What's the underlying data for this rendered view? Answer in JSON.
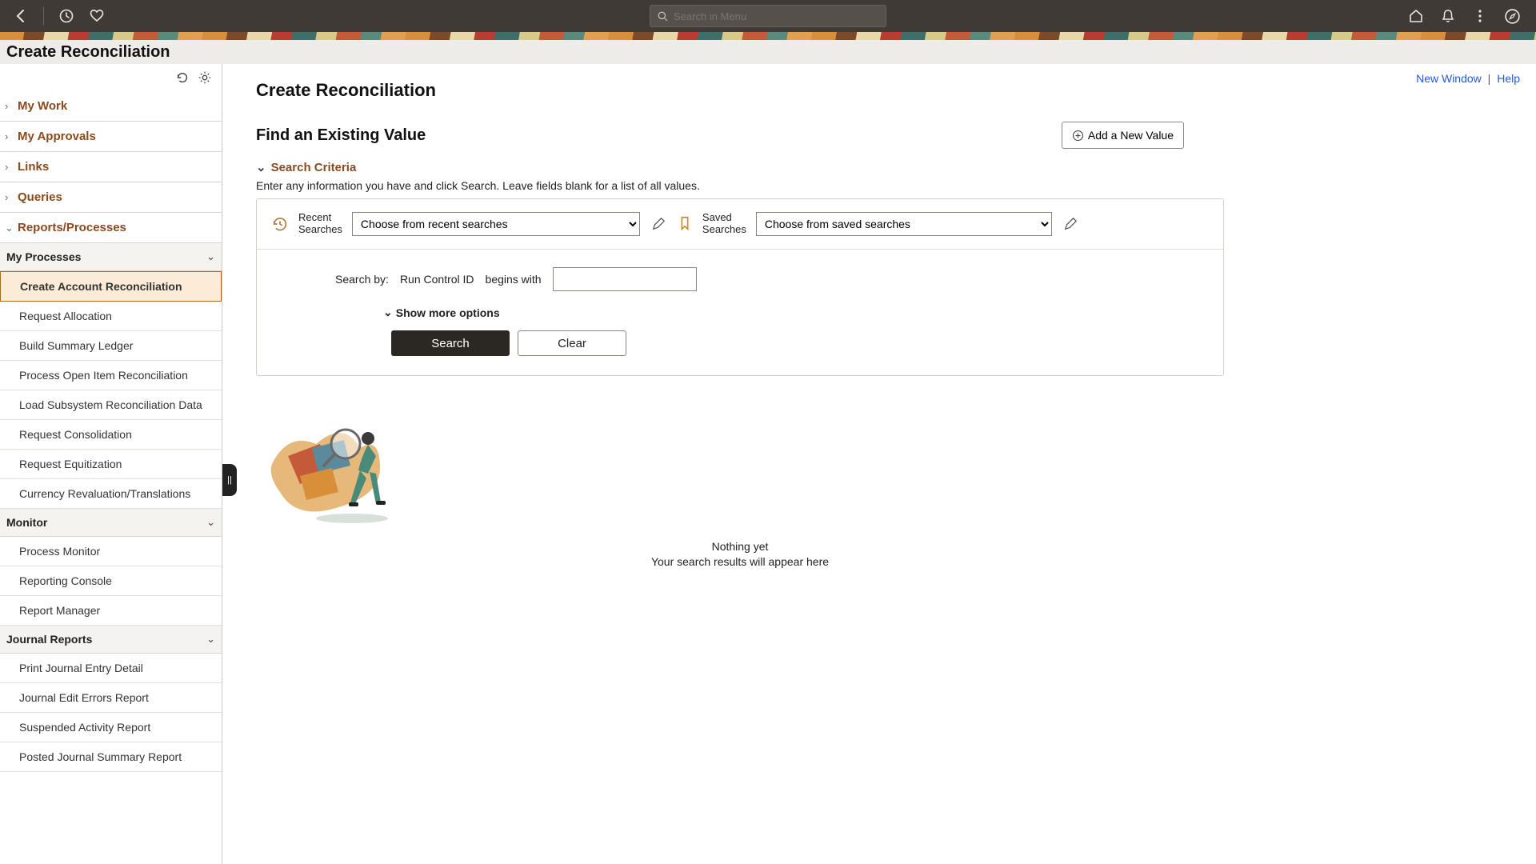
{
  "topbar": {
    "search_placeholder": "Search in Menu"
  },
  "page_title": "Create Reconciliation",
  "top_links": {
    "new_window": "New Window",
    "help": "Help"
  },
  "sidebar": {
    "sections": {
      "my_work": "My Work",
      "my_approvals": "My Approvals",
      "links": "Links",
      "queries": "Queries",
      "reports_processes": "Reports/Processes"
    },
    "groups": {
      "my_processes": {
        "label": "My Processes",
        "items": [
          "Create Account Reconciliation",
          "Request Allocation",
          "Build Summary Ledger",
          "Process Open Item Reconciliation",
          "Load Subsystem Reconciliation Data",
          "Request Consolidation",
          "Request Equitization",
          "Currency Revaluation/Translations"
        ]
      },
      "monitor": {
        "label": "Monitor",
        "items": [
          "Process Monitor",
          "Reporting Console",
          "Report Manager"
        ]
      },
      "journal_reports": {
        "label": "Journal Reports",
        "items": [
          "Print Journal Entry Detail",
          "Journal Edit Errors Report",
          "Suspended Activity Report",
          "Posted Journal Summary Report"
        ]
      }
    }
  },
  "main": {
    "heading": "Create Reconciliation",
    "subheading": "Find an Existing Value",
    "add_new": "Add a New Value",
    "criteria_title": "Search Criteria",
    "criteria_hint": "Enter any information you have and click Search. Leave fields blank for a list of all values.",
    "recent_label": "Recent\nSearches",
    "recent_placeholder": "Choose from recent searches",
    "saved_label": "Saved\nSearches",
    "saved_placeholder": "Choose from saved searches",
    "search_by_label": "Search by:",
    "search_field": "Run Control ID",
    "operator": "begins with",
    "show_more": "Show more options",
    "search_btn": "Search",
    "clear_btn": "Clear",
    "empty_line1": "Nothing yet",
    "empty_line2": "Your search results will appear here"
  }
}
